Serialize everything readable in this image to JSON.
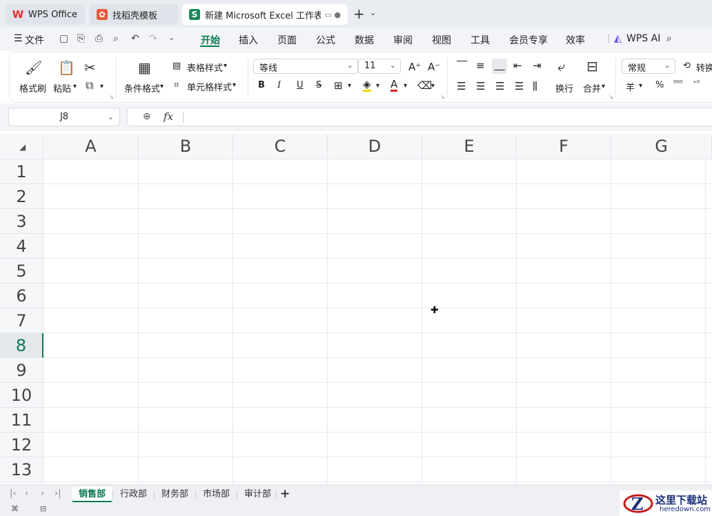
{
  "tabs": [
    {
      "label": "WPS Office"
    },
    {
      "label": "找稻壳模板"
    },
    {
      "label": "新建 Microsoft Excel 工作表"
    }
  ],
  "menu": {
    "file": "文件",
    "items": [
      "开始",
      "插入",
      "页面",
      "公式",
      "数据",
      "审阅",
      "视图",
      "工具",
      "会员专享",
      "效率"
    ],
    "ai": "WPS AI"
  },
  "ribbon": {
    "format_painter": "格式刷",
    "paste": "粘贴",
    "cond_format": "条件格式",
    "table_style": "表格样式",
    "cell_style": "单元格样式",
    "font_name": "等线",
    "font_size": "11",
    "wrap": "换行",
    "merge": "合并",
    "number_format": "常规",
    "convert": "转换",
    "bold": "B",
    "italic": "I",
    "underline": "U",
    "strike": "S",
    "currency": "羊",
    "percent": "%"
  },
  "formula_bar": {
    "name_box": "J8",
    "fx": "fx"
  },
  "grid": {
    "columns": [
      "A",
      "B",
      "C",
      "D",
      "E",
      "F",
      "G"
    ],
    "rows": [
      "1",
      "2",
      "3",
      "4",
      "5",
      "6",
      "7",
      "8",
      "9",
      "10",
      "11",
      "12",
      "13"
    ],
    "active_row": "8"
  },
  "sheets": [
    "销售部",
    "行政部",
    "财务部",
    "市场部",
    "审计部"
  ],
  "active_sheet": "销售部",
  "watermark": {
    "name": "这里下载站",
    "url": "heredown.com"
  },
  "colors": {
    "accent": "#0a7a52"
  }
}
